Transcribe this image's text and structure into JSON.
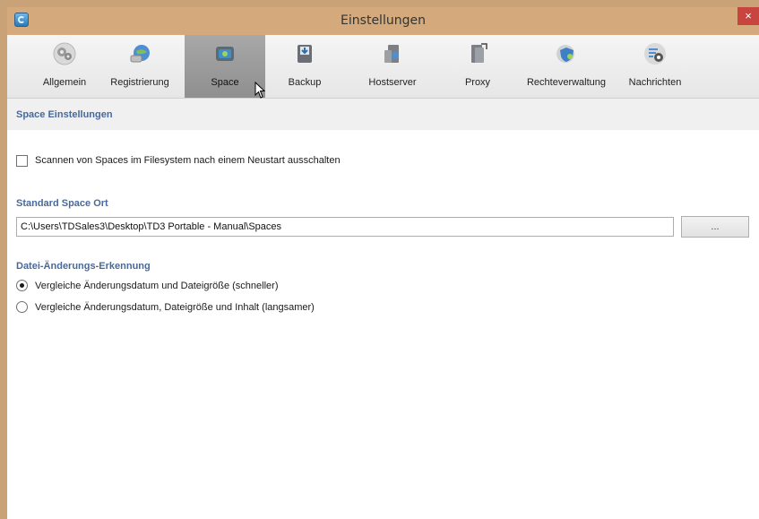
{
  "window": {
    "title": "Einstellungen",
    "close_glyph": "×"
  },
  "toolbar": {
    "items": [
      {
        "label": "Allgemein",
        "icon": "gears-icon"
      },
      {
        "label": "Registrierung",
        "icon": "registration-globe-icon"
      },
      {
        "label": "Space",
        "icon": "space-folder-icon",
        "active": true
      },
      {
        "label": "Backup",
        "icon": "backup-disk-icon"
      },
      {
        "label": "Hostserver",
        "icon": "hostserver-icon"
      },
      {
        "label": "Proxy",
        "icon": "proxy-server-icon"
      },
      {
        "label": "Rechteverwaltung",
        "icon": "rights-shield-icon"
      },
      {
        "label": "Nachrichten",
        "icon": "messages-icon"
      }
    ]
  },
  "main": {
    "section_title": "Space Einstellungen",
    "scan_option": {
      "label": "Scannen von Spaces im Filesystem nach einem Neustart ausschalten",
      "checked": false
    },
    "default_location": {
      "title": "Standard Space Ort",
      "path": "C:\\Users\\TDSales3\\Desktop\\TD3 Portable - Manual\\Spaces",
      "browse_label": "..."
    },
    "change_detection": {
      "title": "Datei-Änderungs-Erkennung",
      "options": [
        {
          "label": "Vergleiche Änderungsdatum und Dateigröße (schneller)",
          "checked": true
        },
        {
          "label": "Vergleiche Änderungsdatum, Dateigröße und Inhalt (langsamer)",
          "checked": false
        }
      ]
    }
  },
  "colors": {
    "accent_text": "#48699b",
    "title_bar": "#d4aa7d",
    "close": "#c7443f"
  }
}
